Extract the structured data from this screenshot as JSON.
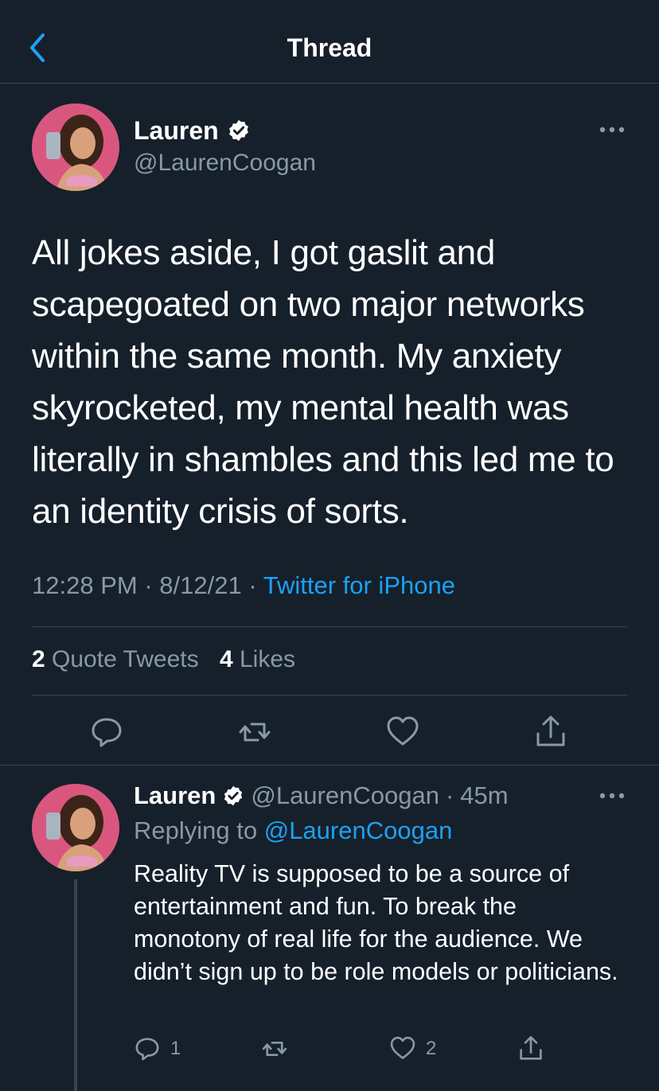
{
  "header": {
    "title": "Thread",
    "back_icon": "chevron-left-icon"
  },
  "colors": {
    "background": "#15202b",
    "divider": "#38444d",
    "muted": "#8899a6",
    "accent": "#1da1f2",
    "text": "#ffffff"
  },
  "main_tweet": {
    "author_name": "Lauren",
    "handle": "@LaurenCoogan",
    "verified_icon": "verified-badge-icon",
    "text": "All jokes aside, I got gaslit and scapegoated on two major networks within the same month. My anxiety skyrocketed, my mental health was literally in shambles and this led me to an identity crisis of sorts.",
    "time": "12:28 PM",
    "date": "8/12/21",
    "source": "Twitter for iPhone",
    "quote_tweets_count": "2",
    "quote_tweets_label": "Quote Tweets",
    "likes_count": "4",
    "likes_label": "Likes"
  },
  "reply_tweet": {
    "author_name": "Lauren",
    "handle": "@LaurenCoogan",
    "age": "45m",
    "replying_prefix": "Replying to",
    "replying_to": "@LaurenCoogan",
    "text": "Reality TV is supposed to be a source of entertainment and fun. To break the monotony of real life for the audience. We didn’t sign up to be role models or politicians.",
    "reply_count": "1",
    "like_count": "2"
  }
}
